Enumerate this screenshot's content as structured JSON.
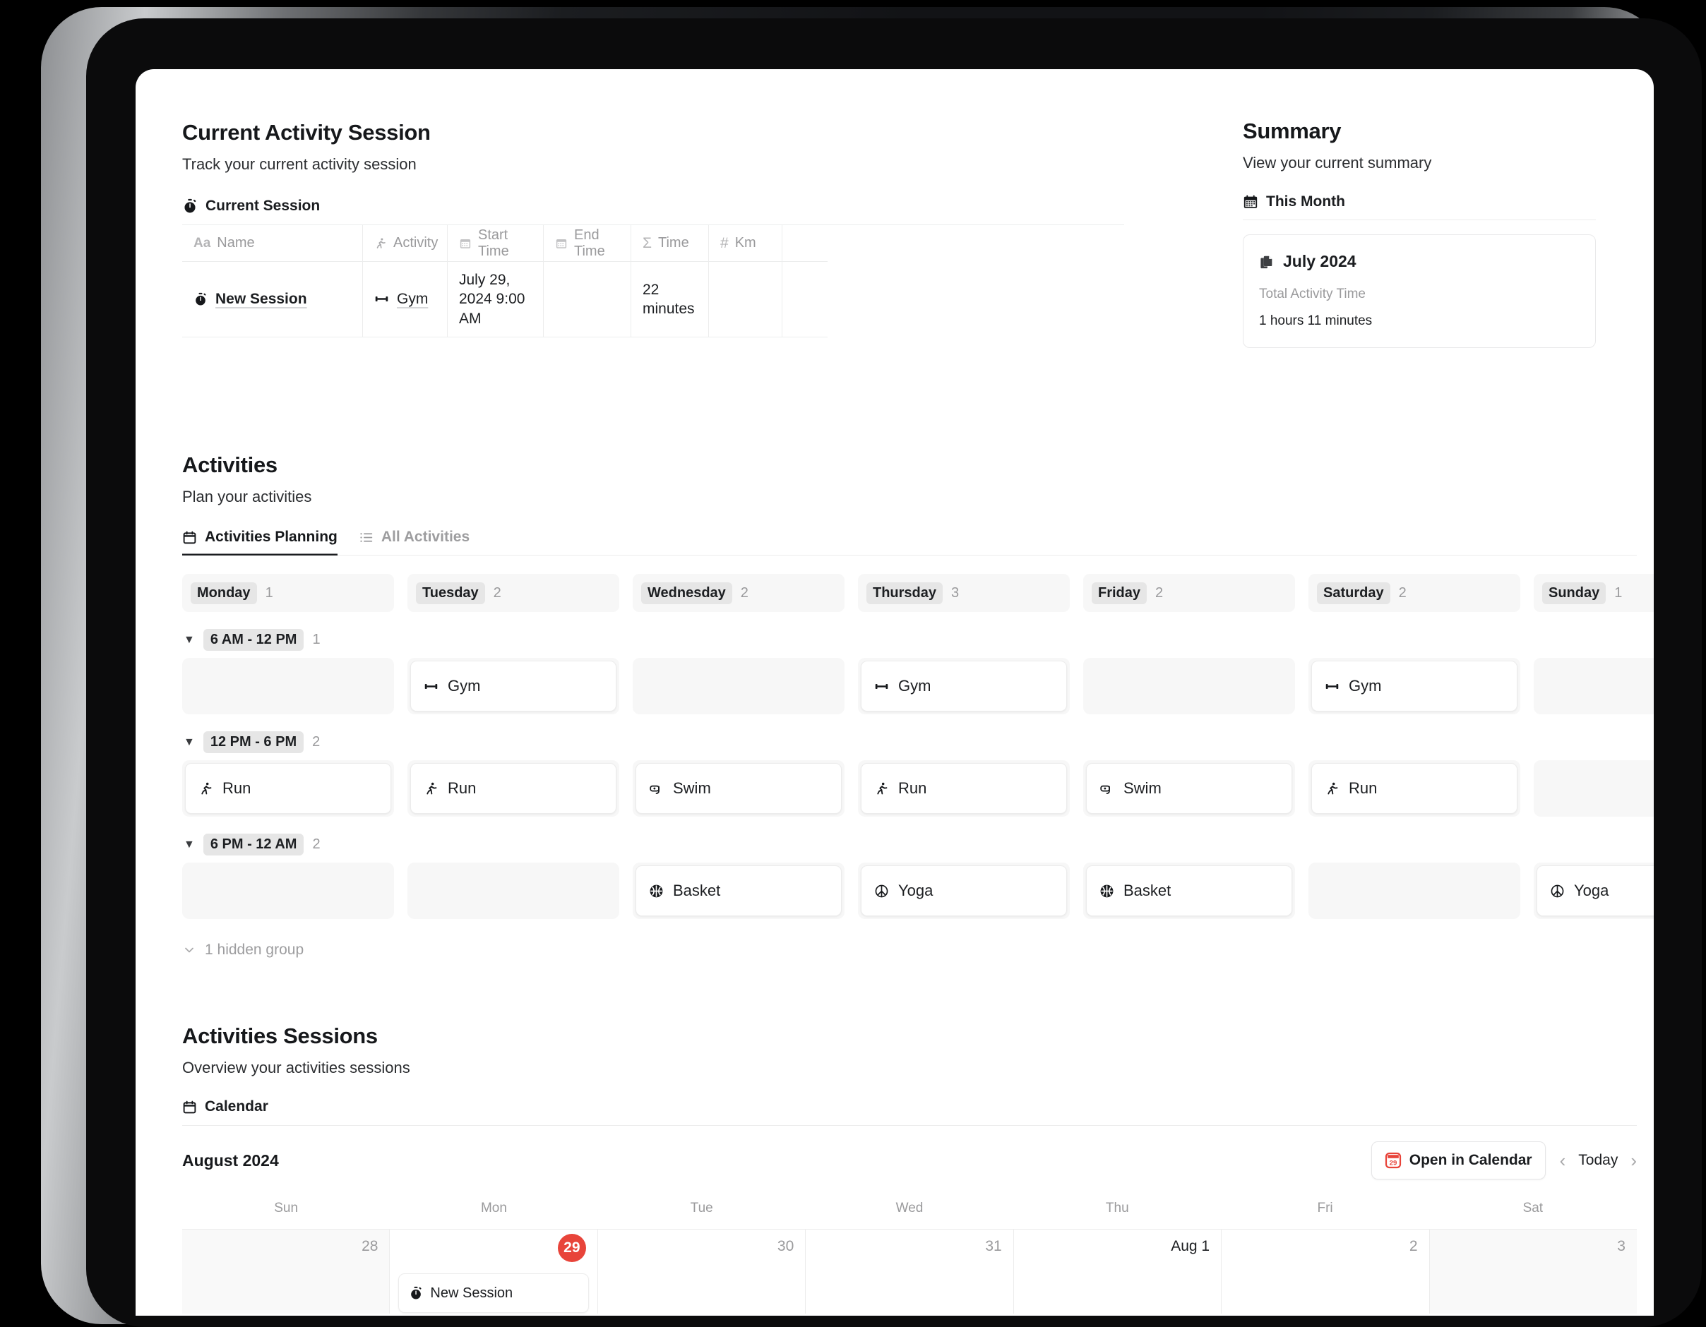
{
  "current_session": {
    "title": "Current Activity Session",
    "subtitle": "Track your current activity session",
    "tab_label": "Current Session",
    "tab_icon": "stopwatch-icon",
    "columns": [
      {
        "label": "Name",
        "icon": "text-aa-icon"
      },
      {
        "label": "Activity",
        "icon": "runner-icon"
      },
      {
        "label": "Start Time",
        "icon": "calendar-icon"
      },
      {
        "label": "End Time",
        "icon": "calendar-icon"
      },
      {
        "label": "Time",
        "icon": "sigma-icon"
      },
      {
        "label": "Km",
        "icon": "hash-icon"
      }
    ],
    "row": {
      "name": "New Session",
      "name_icon": "stopwatch-icon",
      "activity": "Gym",
      "activity_icon": "dumbbell-icon",
      "start_time": "July 29, 2024 9:00 AM",
      "end_time": "",
      "time": "22 minutes",
      "km": ""
    }
  },
  "summary": {
    "title": "Summary",
    "subtitle": "View your current summary",
    "tab_label": "This Month",
    "tab_icon": "calendar-grid-icon",
    "card": {
      "icon": "pages-icon",
      "title": "July 2024",
      "label": "Total Activity Time",
      "value": "1 hours 11 minutes"
    }
  },
  "activities": {
    "title": "Activities",
    "subtitle": "Plan your activities",
    "tabs": [
      {
        "label": "Activities Planning",
        "icon": "calendar-icon",
        "active": true
      },
      {
        "label": "All Activities",
        "icon": "list-icon",
        "active": false
      }
    ],
    "days": [
      {
        "label": "Monday",
        "count": "1"
      },
      {
        "label": "Tuesday",
        "count": "2"
      },
      {
        "label": "Wednesday",
        "count": "2"
      },
      {
        "label": "Thursday",
        "count": "3"
      },
      {
        "label": "Friday",
        "count": "2"
      },
      {
        "label": "Saturday",
        "count": "2"
      },
      {
        "label": "Sunday",
        "count": "1"
      }
    ],
    "groups": [
      {
        "label": "6 AM - 12 PM",
        "count": "1",
        "cells": [
          {
            "label": "",
            "icon": ""
          },
          {
            "label": "Gym",
            "icon": "dumbbell-icon"
          },
          {
            "label": "",
            "icon": ""
          },
          {
            "label": "Gym",
            "icon": "dumbbell-icon"
          },
          {
            "label": "",
            "icon": ""
          },
          {
            "label": "Gym",
            "icon": "dumbbell-icon"
          },
          {
            "label": "",
            "icon": ""
          }
        ]
      },
      {
        "label": "12 PM - 6 PM",
        "count": "2",
        "cells": [
          {
            "label": "Run",
            "icon": "runner-icon"
          },
          {
            "label": "Run",
            "icon": "runner-icon"
          },
          {
            "label": "Swim",
            "icon": "snorkel-icon"
          },
          {
            "label": "Run",
            "icon": "runner-icon"
          },
          {
            "label": "Swim",
            "icon": "snorkel-icon"
          },
          {
            "label": "Run",
            "icon": "runner-icon"
          },
          {
            "label": "",
            "icon": ""
          }
        ]
      },
      {
        "label": "6 PM - 12 AM",
        "count": "2",
        "cells": [
          {
            "label": "",
            "icon": ""
          },
          {
            "label": "",
            "icon": ""
          },
          {
            "label": "Basket",
            "icon": "basketball-icon"
          },
          {
            "label": "Yoga",
            "icon": "yoga-icon"
          },
          {
            "label": "Basket",
            "icon": "basketball-icon"
          },
          {
            "label": "",
            "icon": ""
          },
          {
            "label": "Yoga",
            "icon": "yoga-icon"
          }
        ]
      }
    ],
    "hidden_group_label": "1 hidden group"
  },
  "sessions": {
    "title": "Activities Sessions",
    "subtitle": "Overview your activities sessions",
    "tab_label": "Calendar",
    "tab_icon": "calendar-icon",
    "month": "August 2024",
    "open_in_calendar_label": "Open in Calendar",
    "open_in_calendar_icon": "calendar-app-icon",
    "open_in_calendar_badge": "29",
    "today_label": "Today",
    "prev_icon": "chevron-left-icon",
    "next_icon": "chevron-right-icon",
    "weekdays": [
      "Sun",
      "Mon",
      "Tue",
      "Wed",
      "Thu",
      "Fri",
      "Sat"
    ],
    "days": [
      {
        "num": "28",
        "muted": true,
        "today": false,
        "event": null
      },
      {
        "num": "29",
        "muted": false,
        "today": true,
        "event": {
          "label": "New Session",
          "icon": "stopwatch-icon"
        }
      },
      {
        "num": "30",
        "muted": false,
        "today": false,
        "event": null
      },
      {
        "num": "31",
        "muted": false,
        "today": false,
        "event": null
      },
      {
        "num": "Aug 1",
        "muted": false,
        "today": false,
        "event": null,
        "strong": true
      },
      {
        "num": "2",
        "muted": false,
        "today": false,
        "event": null
      },
      {
        "num": "3",
        "muted": true,
        "today": false,
        "event": null
      }
    ]
  },
  "colors": {
    "today_red": "#e8443a",
    "chip_gray": "#e6e6e6",
    "lane_gray": "#f7f7f7",
    "border": "#ececec"
  }
}
